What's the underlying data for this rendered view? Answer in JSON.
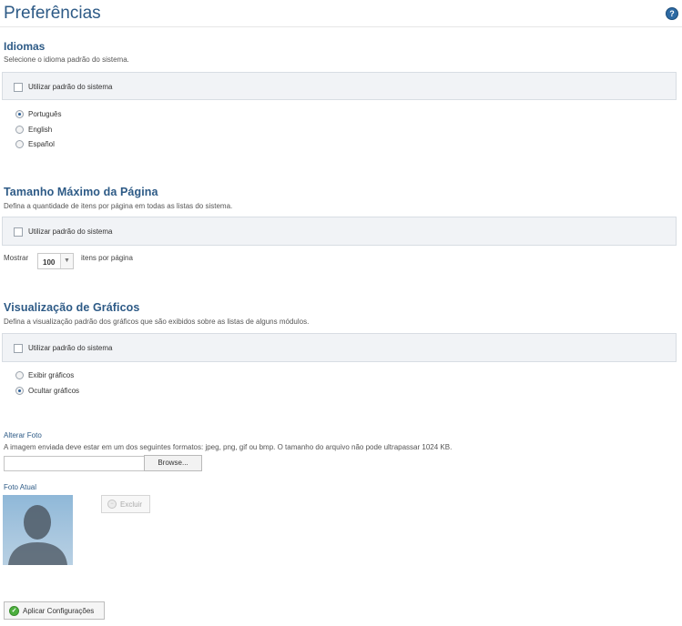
{
  "page": {
    "title": "Preferências",
    "help_icon": "help-icon"
  },
  "languages": {
    "title": "Idiomas",
    "description": "Selecione o idioma padrão do sistema.",
    "use_default_label": "Utilizar padrão do sistema",
    "use_default_checked": false,
    "options": [
      {
        "label": "Português",
        "selected": true
      },
      {
        "label": "English",
        "selected": false
      },
      {
        "label": "Español",
        "selected": false
      }
    ]
  },
  "page_size": {
    "title": "Tamanho Máximo da Página",
    "description": "Defina a quantidade de itens por página em todas as listas do sistema.",
    "use_default_label": "Utilizar padrão do sistema",
    "use_default_checked": false,
    "show_label": "Mostrar",
    "value": "100",
    "suffix": "itens por página"
  },
  "charts": {
    "title": "Visualização de Gráficos",
    "description": "Defina a visualização padrão dos gráficos que são exibidos sobre as listas de alguns módulos.",
    "use_default_label": "Utilizar padrão do sistema",
    "use_default_checked": false,
    "options": [
      {
        "label": "Exibir gráficos",
        "selected": false
      },
      {
        "label": "Ocultar gráficos",
        "selected": true
      }
    ]
  },
  "photo": {
    "title": "Alterar Foto",
    "description": "A imagem enviada deve estar em um dos seguintes formatos: jpeg, png, gif ou bmp. O tamanho do arquivo não pode ultrapassar 1024 KB.",
    "browse_label": "Browse...",
    "file_value": "",
    "current_label": "Foto Atual",
    "delete_label": "Excluir"
  },
  "apply_label": "Aplicar Configurações",
  "colors": {
    "accent": "#2d5a86",
    "bar_bg": "#f1f3f6",
    "apply_icon": "#4caf3e"
  }
}
